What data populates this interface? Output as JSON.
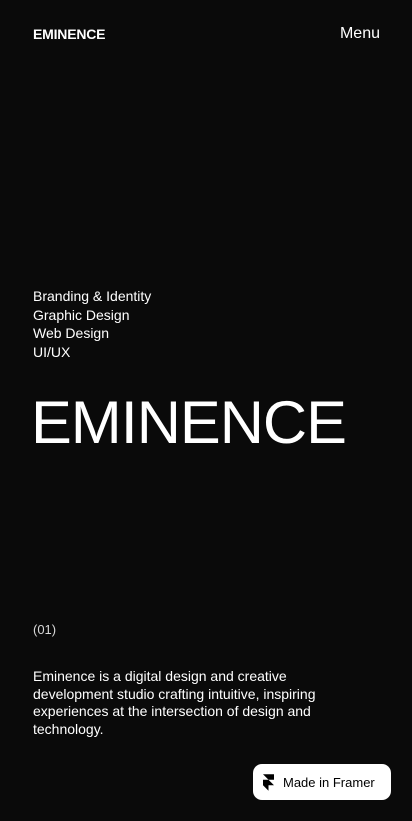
{
  "header": {
    "logo": "EMINENCE",
    "menu_label": "Menu"
  },
  "services": [
    "Branding & Identity",
    "Graphic Design",
    "Web Design",
    "UI/UX"
  ],
  "hero": {
    "title": "EMINENCE"
  },
  "about": {
    "section_number": "(01)",
    "description": "Eminence is a digital design and creative development studio crafting intuitive, inspiring experiences at the intersection of design and technology."
  },
  "badge": {
    "label": "Made in Framer",
    "icon": "framer-icon"
  },
  "colors": {
    "background": "#0a0a0a",
    "text": "#ffffff",
    "badge_background": "#ffffff"
  }
}
